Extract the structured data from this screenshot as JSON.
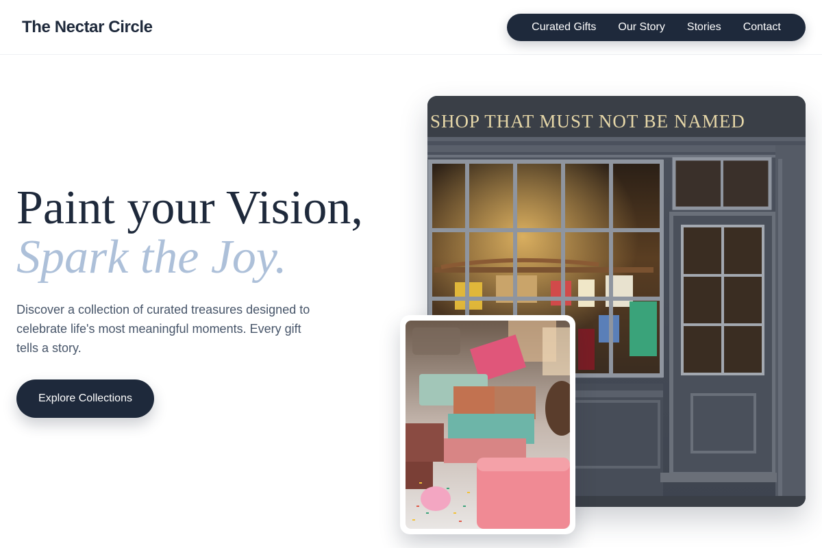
{
  "brand": {
    "name": "The Nectar Circle"
  },
  "nav": {
    "items": [
      {
        "label": "Curated Gifts"
      },
      {
        "label": "Our Story"
      },
      {
        "label": "Stories"
      },
      {
        "label": "Contact"
      }
    ]
  },
  "hero": {
    "title_line1": "Paint your Vision,",
    "title_line2": "Spark the Joy.",
    "description": "Discover a collection of curated treasures designed to celebrate life's most meaningful moments. Every gift tells a story.",
    "cta_label": "Explore Collections"
  },
  "images": {
    "storefront": {
      "sign_text": "SHOP THAT MUST NOT BE NAMED"
    },
    "gifts": {}
  },
  "colors": {
    "primary": "#1e293b",
    "accent": "#adc0d9",
    "body_text": "#475569"
  }
}
